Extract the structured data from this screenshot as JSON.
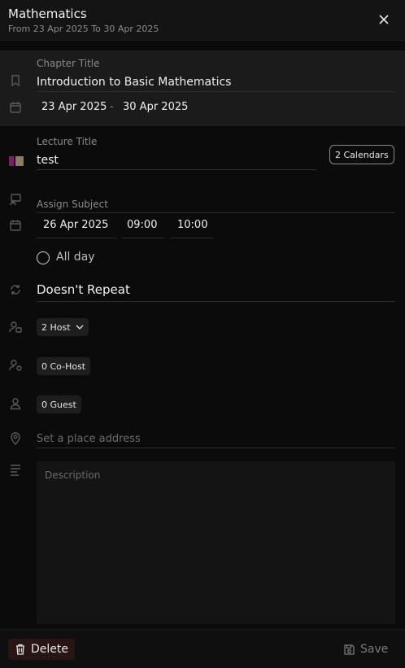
{
  "header": {
    "title": "Mathematics",
    "subtitle": "From 23 Apr 2025 To 30 Apr 2025"
  },
  "chapter": {
    "label": "Chapter Title",
    "value": "Introduction to Basic Mathematics",
    "start_date": "23 Apr 2025",
    "separator": "-",
    "end_date": "30 Apr 2025"
  },
  "lecture": {
    "label": "Lecture Title",
    "value": "test",
    "calendars_button": "2 Calendars",
    "color_swatches": [
      "#7a1f6a",
      "#8a7a66"
    ]
  },
  "assign_subject": {
    "label": "Assign Subject"
  },
  "schedule": {
    "date": "26 Apr 2025",
    "start_time": "09:00",
    "end_time": "10:00",
    "all_day_label": "All day"
  },
  "repeat": {
    "value": "Doesn't Repeat"
  },
  "participants": {
    "host": "2  Host",
    "cohost": "0  Co-Host",
    "guest": "0  Guest"
  },
  "location": {
    "placeholder": "Set a place address"
  },
  "description": {
    "placeholder": "Description"
  },
  "footer": {
    "delete_label": "Delete",
    "save_label": "Save"
  },
  "colors": {
    "background": "#0b0b0b",
    "panel": "#1b1b1b",
    "delete_bg": "#2a1515"
  }
}
